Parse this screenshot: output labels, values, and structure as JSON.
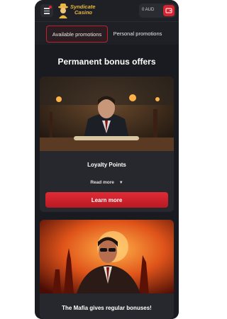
{
  "header": {
    "logo_line1": "Syndicate",
    "logo_line2": "Casino",
    "balance": "0 AUD"
  },
  "tabs": [
    {
      "label": "Available promotions",
      "active": true
    },
    {
      "label": "Personal promotions",
      "active": false
    }
  ],
  "section_title": "Permanent bonus offers",
  "offers": [
    {
      "title": "Loyalty Points",
      "read_more": "Read more",
      "cta": "Learn more"
    },
    {
      "title": "The Mafia gives regular bonuses!"
    }
  ],
  "colors": {
    "background": "#1a1b20",
    "card": "#27282e",
    "accent": "#d7232f",
    "logo": "#e9b640"
  },
  "icons": [
    "menu-icon",
    "wallet-icon",
    "chevron-down-icon"
  ]
}
